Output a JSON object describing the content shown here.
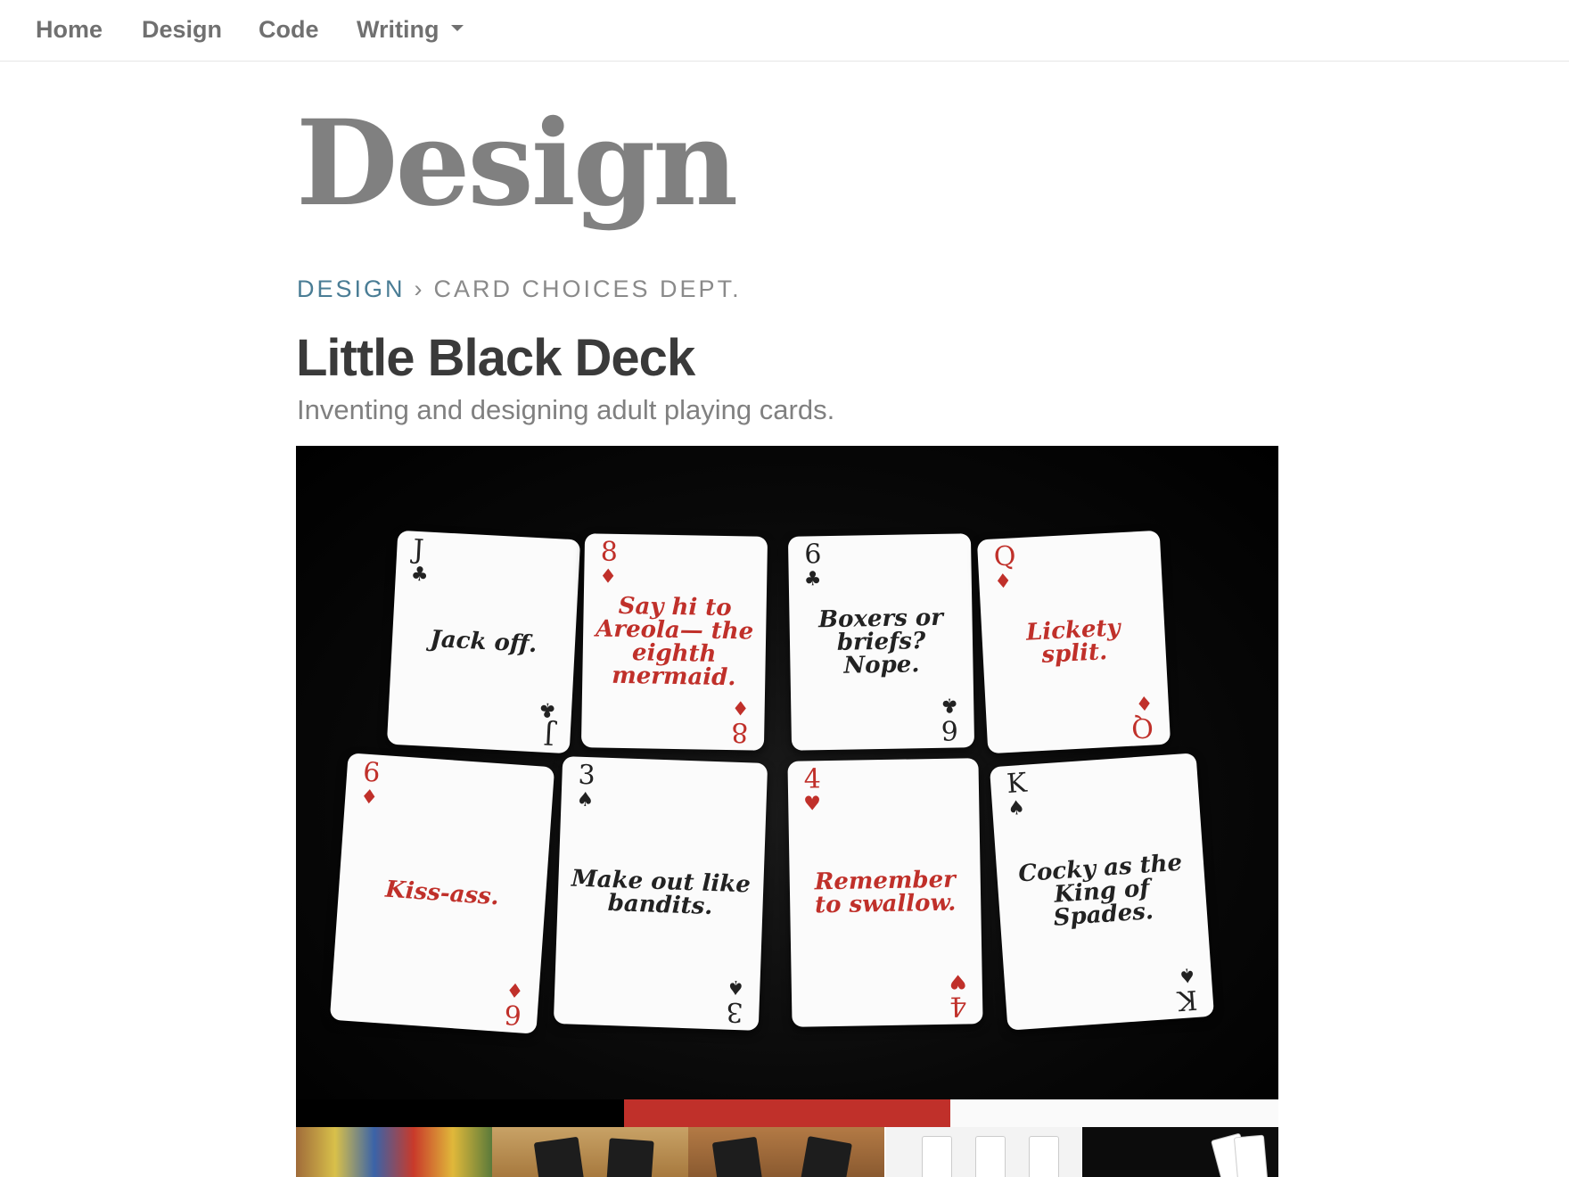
{
  "nav": {
    "items": [
      {
        "label": "Home"
      },
      {
        "label": "Design"
      },
      {
        "label": "Code"
      },
      {
        "label": "Writing"
      }
    ]
  },
  "page": {
    "title": "Design"
  },
  "breadcrumb": {
    "section": "DESIGN",
    "separator": "›",
    "current": "CARD CHOICES DEPT."
  },
  "article": {
    "title": "Little Black Deck",
    "subtitle": "Inventing and designing adult playing cards."
  },
  "hero": {
    "cards": [
      {
        "rank": "J",
        "suit": "♣",
        "color": "black",
        "phrase": "Jack off."
      },
      {
        "rank": "8",
        "suit": "♦",
        "color": "red",
        "phrase": "Say hi to Areola— the eighth mermaid."
      },
      {
        "rank": "6",
        "suit": "♣",
        "color": "black",
        "phrase": "Boxers or briefs? Nope."
      },
      {
        "rank": "Q",
        "suit": "♦",
        "color": "red",
        "phrase": "Lickety split."
      },
      {
        "rank": "6",
        "suit": "♦",
        "color": "red",
        "phrase": "Kiss-ass."
      },
      {
        "rank": "3",
        "suit": "♠",
        "color": "black",
        "phrase": "Make out like bandits."
      },
      {
        "rank": "4",
        "suit": "♥",
        "color": "red",
        "phrase": "Remember to swallow."
      },
      {
        "rank": "K",
        "suit": "♠",
        "color": "black",
        "phrase": "Cocky as the King of Spades."
      }
    ]
  },
  "slider": {
    "active_index": 2,
    "total": 3,
    "accent_color": "#c0302a"
  },
  "colors": {
    "nav_text": "#707070",
    "breadcrumb_link": "#4a7d95",
    "title_gray": "#808080",
    "card_red": "#c0302a"
  }
}
